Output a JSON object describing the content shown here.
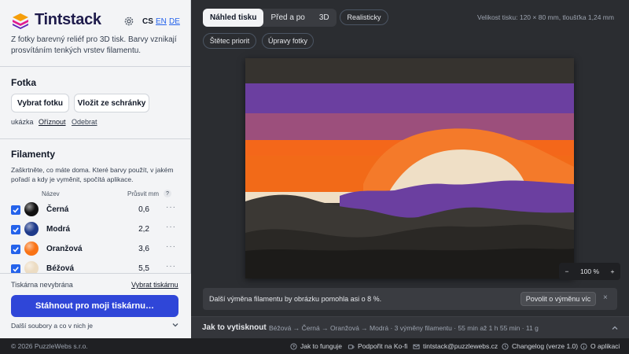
{
  "app": {
    "name": "Tintstack",
    "languages": [
      "CS",
      "EN",
      "DE"
    ],
    "tagline": "Z fotky barevný reliéf pro 3D tisk. Barvy vznikají prosvítáním tenkých vrstev filamentu."
  },
  "photo": {
    "title": "Fotka",
    "choose_label": "Vybrat fotku",
    "paste_label": "Vložit ze schránky",
    "links": [
      "ukázka",
      "Oříznout",
      "Odebrat"
    ]
  },
  "filaments": {
    "title": "Filamenty",
    "description": "Zaškrtněte, co máte doma. Které barvy použít, v jakém pořadí a kdy je vyměnit, spočítá aplikace.",
    "col_name": "Název",
    "col_transmission": "Průsvit mm",
    "help": "?",
    "more": "···",
    "items": [
      {
        "name": "Černá",
        "value": "0,6",
        "checked": true,
        "color": "#111111"
      },
      {
        "name": "Modrá",
        "value": "2,2",
        "checked": true,
        "color": "#1e3a8a"
      },
      {
        "name": "Oranžová",
        "value": "3,6",
        "checked": true,
        "color": "#f97316"
      },
      {
        "name": "Béžová",
        "value": "5,5",
        "checked": true,
        "color": "#ecdcc3"
      }
    ]
  },
  "printer": {
    "status": "Tiskárna nevybrána",
    "choose_label": "Vybrat tiskárnu",
    "download_label": "Stáhnout pro moji tiskárnu…",
    "more_files": "Další soubory a co v nich je"
  },
  "view": {
    "tabs": [
      "Náhled tisku",
      "Před a po",
      "3D"
    ],
    "active_tab": 0,
    "realistic_label": "Realisticky",
    "brush_label": "Štětec priorit",
    "edits_label": "Úpravy fotky",
    "print_size": "Velikost tisku: 120 × 80 mm, tloušťka 1,24 mm",
    "zoom": {
      "minus": "−",
      "value": "100 %",
      "plus": "+"
    }
  },
  "tip": {
    "text": "Další výměna filamentu by obrázku pomohla asi o 8 %.",
    "button": "Povolit o výměnu víc",
    "close": "×"
  },
  "howto": {
    "title": "Jak to vytisknout",
    "summary": "Béžová → Černá → Oranžová → Modrá · 3 výměny filamentu · 55 min až 1 h 55 min · 11 g"
  },
  "footer": {
    "copyright": "© 2026 PuzzleWebs s.r.o.",
    "links": [
      "Jak to funguje",
      "Podpořit na Ko-fi",
      "tintstack@puzzlewebs.cz",
      "Changelog (verze 1.0)",
      "O aplikaci"
    ]
  },
  "colors": {
    "accent": "#2f46d8",
    "purple": "#6b3fa0",
    "mauve": "#9c4f7c",
    "orange": "#f4671a",
    "beige": "#efdfc6",
    "dark": "#35322e"
  }
}
